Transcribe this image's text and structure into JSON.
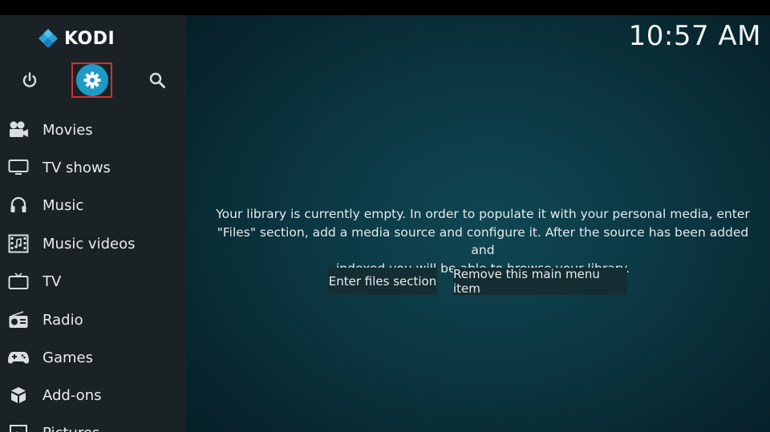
{
  "app": {
    "name": "KODI"
  },
  "clock": "10:57 AM",
  "top_icons": [
    "power-icon",
    "settings-icon",
    "search-icon"
  ],
  "menu": [
    {
      "label": "Movies",
      "icon": "movies-icon"
    },
    {
      "label": "TV shows",
      "icon": "tv-shows-icon"
    },
    {
      "label": "Music",
      "icon": "music-icon"
    },
    {
      "label": "Music videos",
      "icon": "music-videos-icon"
    },
    {
      "label": "TV",
      "icon": "tv-icon"
    },
    {
      "label": "Radio",
      "icon": "radio-icon"
    },
    {
      "label": "Games",
      "icon": "games-icon"
    },
    {
      "label": "Add-ons",
      "icon": "addons-icon"
    },
    {
      "label": "Pictures",
      "icon": "pictures-icon"
    }
  ],
  "main": {
    "message_lines": [
      "Your library is currently empty. In order to populate it with your personal media, enter",
      "\"Files\" section, add a media source and configure it. After the source has been added and",
      "indexed you will be able to browse your library."
    ],
    "buttons": {
      "enter_files": "Enter files section",
      "remove_item": "Remove this main menu item"
    }
  },
  "colors": {
    "accent": "#1e9ac7",
    "highlight_border": "#d32f2f",
    "sidebar_bg": "#1b2226",
    "main_bg": "#0b3641"
  }
}
